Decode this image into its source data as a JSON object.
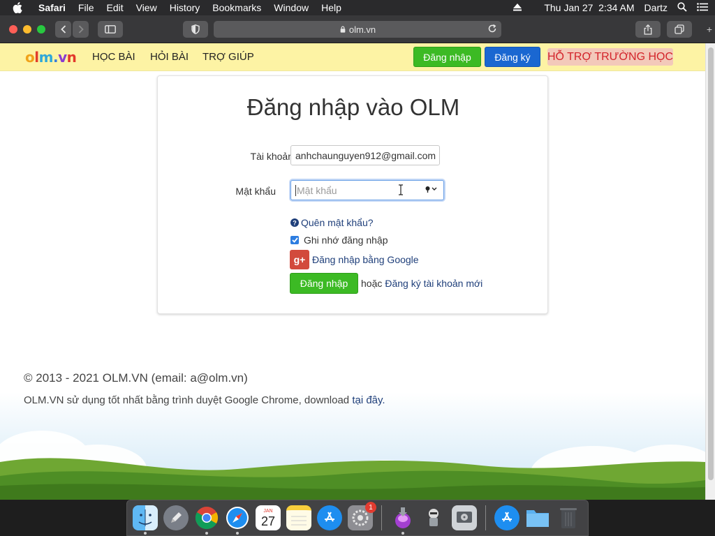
{
  "menubar": {
    "items": [
      "Safari",
      "File",
      "Edit",
      "View",
      "History",
      "Bookmarks",
      "Window",
      "Help"
    ],
    "datetime": "Thu Jan 27  2:34 AM",
    "user": "Dartz"
  },
  "browser": {
    "url": "olm.vn"
  },
  "site": {
    "logo": {
      "o": "o",
      "l": "l",
      "m": "m",
      "dot": ".",
      "v": "v",
      "n": "n"
    },
    "nav": [
      "HỌC BÀI",
      "HỎI BÀI",
      "TRỢ GIÚP"
    ],
    "login_btn": "Đăng nhập",
    "register_btn": "Đăng ký",
    "support_btn": "HỖ TRỢ TRƯỜNG HỌC"
  },
  "login": {
    "title": "Đăng nhập vào OLM",
    "account_label": "Tài khoản",
    "account_value": "anhchaunguyen912@gmail.com",
    "password_label": "Mật khẩu",
    "password_placeholder": "Mật khẩu",
    "forgot": "Quên mật khẩu?",
    "remember": "Ghi nhớ đăng nhập",
    "remember_checked": true,
    "google": "Đăng nhập bằng Google",
    "google_icon_text": "g+",
    "submit": "Đăng nhập",
    "or": "hoặc",
    "register_link": "Đăng ký tài khoản mới"
  },
  "footer": {
    "copyright": "© 2013 - 2021 OLM.VN (email: a@olm.vn)",
    "browser_note": "OLM.VN sử dụng tốt nhất bằng trình duyệt Google Chrome, download",
    "download_link": "tại đây."
  },
  "dock": {
    "calendar_month": "JAN",
    "calendar_day": "27",
    "settings_badge": "1"
  },
  "colors": {
    "nav_bg": "#fdf3a4",
    "green_btn": "#3cba24",
    "blue_btn": "#1a67d1",
    "support_text": "#d3232a",
    "link": "#1f3f7a"
  }
}
